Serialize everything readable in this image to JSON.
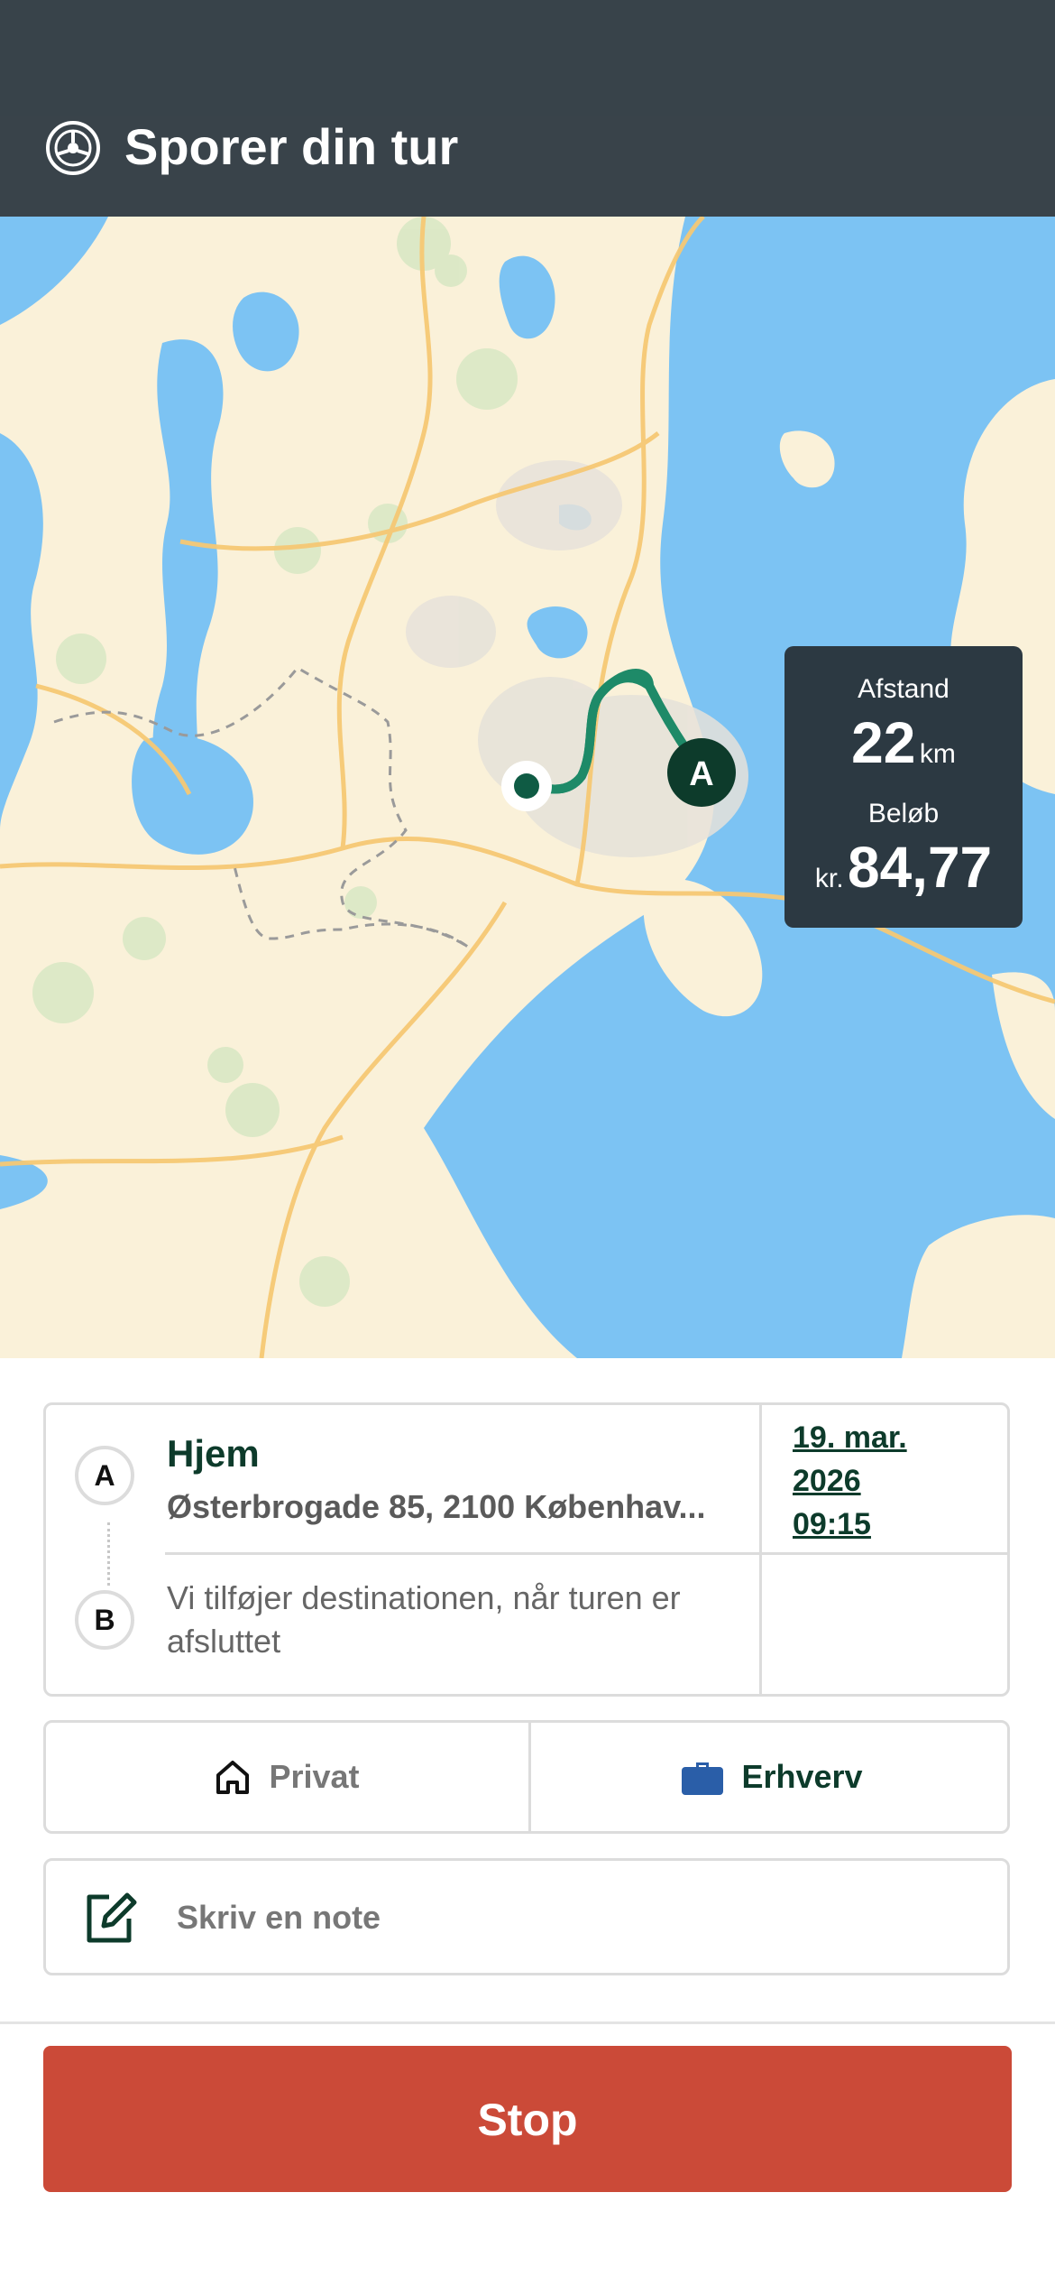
{
  "header": {
    "title": "Sporer din tur",
    "icon": "steering-wheel-icon"
  },
  "stats": {
    "distance_label": "Afstand",
    "distance_value": "22",
    "distance_unit": "km",
    "amount_label": "Beløb",
    "amount_prefix": "kr.",
    "amount_value": "84,77"
  },
  "map": {
    "start_marker_label": "A",
    "route_color": "#1e8a68"
  },
  "trip": {
    "start_badge": "A",
    "end_badge": "B",
    "start_name": "Hjem",
    "start_address": "Østerbrogade 85, 2100 Københav...",
    "destination_placeholder": "Vi tilføjer destinationen, når turen er afsluttet",
    "date_line1": "19. mar.",
    "date_line2": "2026",
    "time": "09:15"
  },
  "category": {
    "private_label": "Privat",
    "business_label": "Erhverv",
    "selected": "Erhverv",
    "business_color": "#2a5ea8"
  },
  "note": {
    "placeholder": "Skriv en note"
  },
  "actions": {
    "stop_label": "Stop",
    "stop_color": "#cb4a38"
  }
}
